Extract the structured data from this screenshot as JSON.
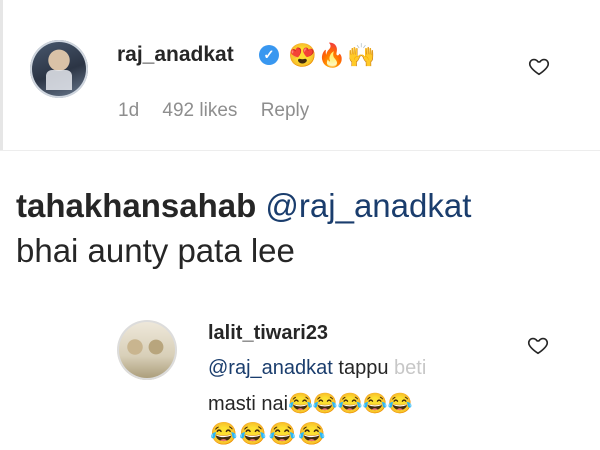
{
  "comment1": {
    "username": "raj_anadkat",
    "verified_icon": "verified-badge-icon",
    "emojis": "😍🔥🙌",
    "time": "1d",
    "likes": "492 likes",
    "reply": "Reply"
  },
  "caption": {
    "username": "tahakhansahab",
    "mention": "@raj_anadkat",
    "body": "bhai aunty pata lee"
  },
  "comment2": {
    "username": "lalit_tiwari23",
    "mention": "@raj_anadkat",
    "text_visible": "tappu",
    "text_faded": " beti",
    "line2_text": "masti nai",
    "line2_emojis": "😂😂😂😂😂",
    "line3_emojis": "😂😂😂😂"
  },
  "colors": {
    "mention": "#1a3d6d",
    "verified": "#3897f0",
    "meta": "#8e8e8e"
  }
}
